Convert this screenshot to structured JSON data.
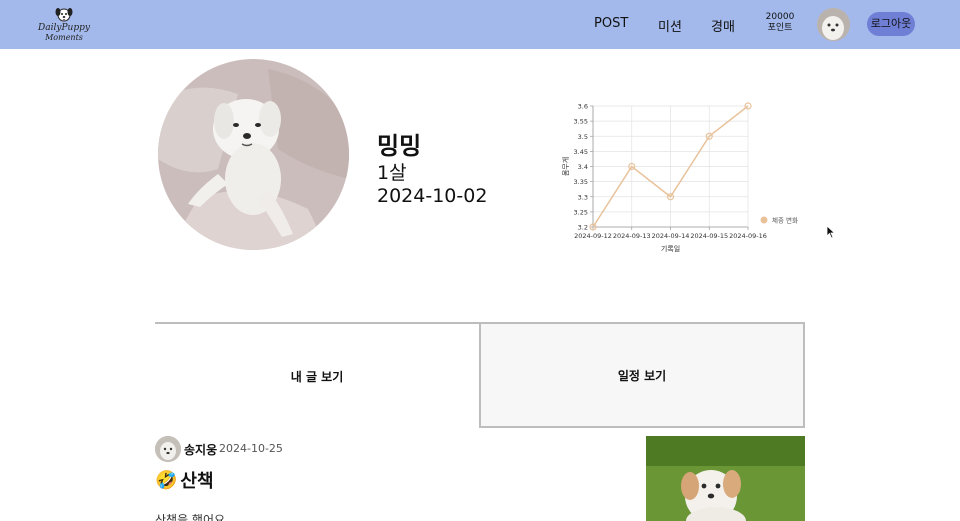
{
  "header": {
    "logo_line1": "DailyPuppy",
    "logo_line2": "Moments",
    "nav": [
      "POST",
      "미션",
      "경매"
    ],
    "points_value": "20000",
    "points_label": "포인트",
    "logout_label": "로그아웃"
  },
  "profile": {
    "name": "밍밍",
    "age": "1살",
    "birthday": "2024-10-02"
  },
  "chart_data": {
    "type": "line",
    "x": [
      "2024-09-12",
      "2024-09-13",
      "2024-09-14",
      "2024-09-15",
      "2024-09-16"
    ],
    "series": [
      {
        "name": "체중 변화",
        "values": [
          3.2,
          3.4,
          3.3,
          3.5,
          3.6
        ]
      }
    ],
    "xlabel": "기록일",
    "ylabel": "몸무게",
    "ylim": [
      3.2,
      3.6
    ],
    "yticks": [
      "3.6",
      "3.55",
      "3.5",
      "3.45",
      "3.4",
      "3.35",
      "3.3",
      "3.25",
      "3.2"
    ],
    "grid": true,
    "legend_position": "right",
    "series_color": "#e8c29a"
  },
  "tabs": {
    "posts": "내 글 보기",
    "schedule": "일정 보기"
  },
  "post": {
    "author": "송지웅",
    "date": "2024-10-25",
    "emoji": "🤣",
    "title": "산책",
    "body": "산책을 했어요"
  },
  "colors": {
    "header_bg": "#a3b9ec",
    "logout_bg": "#6f7fd6"
  }
}
